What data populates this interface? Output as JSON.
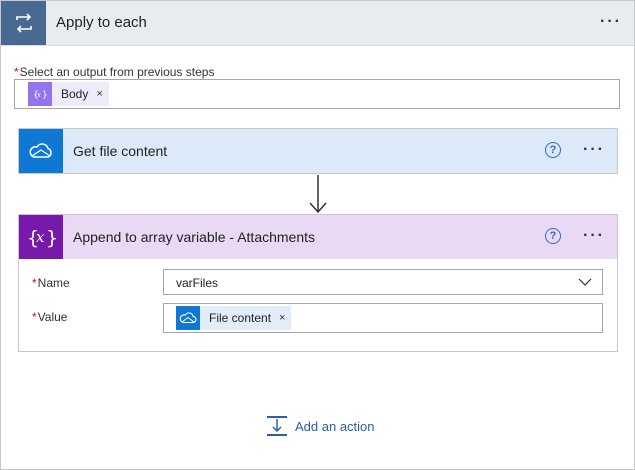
{
  "loop": {
    "title": "Apply to each",
    "more": "···",
    "output_label": "Select an output from previous steps",
    "token": {
      "label": "Body",
      "remove": "×",
      "icon": "expression-icon"
    }
  },
  "step1": {
    "title": "Get file content",
    "help": "?",
    "more": "···",
    "icon": "onedrive-cloud-icon",
    "color": "#0f78d4",
    "header_bg": "#dbe9f9"
  },
  "step2": {
    "title": "Append to array variable - Attachments",
    "help": "?",
    "more": "···",
    "icon": "variable-icon",
    "color": "#7719aa",
    "header_bg": "#ead9f5",
    "name_label": "Name",
    "name_value": "varFiles",
    "value_label": "Value",
    "value_token": {
      "label": "File content",
      "remove": "×",
      "icon": "onedrive-cloud-icon"
    }
  },
  "add_action": {
    "label": "Add an action"
  },
  "required_star": "*"
}
